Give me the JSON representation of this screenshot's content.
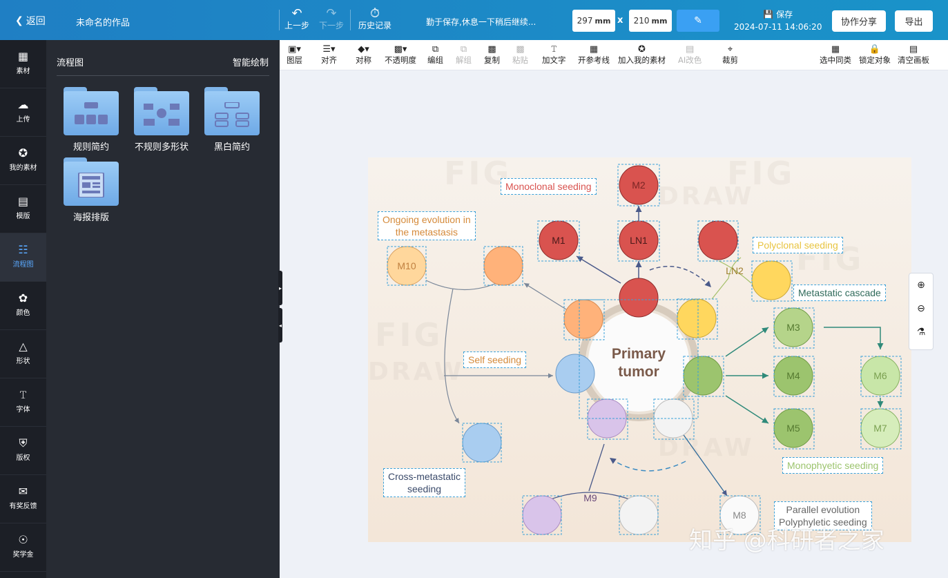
{
  "header": {
    "back_label": "返回",
    "doc_title": "未命名的作品",
    "undo_label": "上一步",
    "redo_label": "下一步",
    "history_label": "历史记录",
    "save_hint": "勤于保存,休息一下稍后继续...",
    "width_value": "297",
    "height_value": "210",
    "unit": "mm",
    "times": "x",
    "save_label": "保存",
    "save_time": "2024-07-11 14:06:20",
    "share_label": "协作分享",
    "export_label": "导出"
  },
  "leftnav": {
    "items": [
      {
        "label": "素材",
        "icon": "grid-icon"
      },
      {
        "label": "上传",
        "icon": "upload-icon"
      },
      {
        "label": "我的素材",
        "icon": "star-icon"
      },
      {
        "label": "模版",
        "icon": "template-icon"
      },
      {
        "label": "流程图",
        "icon": "flowchart-icon"
      },
      {
        "label": "颜色",
        "icon": "palette-icon"
      },
      {
        "label": "形状",
        "icon": "shapes-icon"
      },
      {
        "label": "字体",
        "icon": "text-icon"
      },
      {
        "label": "版权",
        "icon": "copyright-icon"
      },
      {
        "label": "有奖反馈",
        "icon": "feedback-icon"
      },
      {
        "label": "奖学金",
        "icon": "medal-icon"
      }
    ]
  },
  "panel": {
    "title": "流程图",
    "smart_label": "智能绘制",
    "folders": [
      {
        "label": "规则简约"
      },
      {
        "label": "不规则多形状"
      },
      {
        "label": "黑白简约"
      },
      {
        "label": "海报排版"
      }
    ]
  },
  "toolbar": {
    "tools": [
      {
        "label": "图层",
        "icon": "layer-icon"
      },
      {
        "label": "对齐",
        "icon": "align-icon"
      },
      {
        "label": "对称",
        "icon": "symmetry-icon"
      },
      {
        "label": "不透明度",
        "icon": "opacity-icon"
      },
      {
        "label": "编组",
        "icon": "group-icon"
      },
      {
        "label": "解组",
        "icon": "ungroup-icon"
      },
      {
        "label": "复制",
        "icon": "copy-icon"
      },
      {
        "label": "粘贴",
        "icon": "paste-icon"
      },
      {
        "label": "加文字",
        "icon": "add-text-icon"
      },
      {
        "label": "开参考线",
        "icon": "guide-icon"
      },
      {
        "label": "加入我的素材",
        "icon": "add-material-icon"
      },
      {
        "label": "AI改色",
        "icon": "ai-color-icon"
      },
      {
        "label": "裁剪",
        "icon": "crop-icon"
      },
      {
        "label": "选中同类",
        "icon": "select-similar-icon"
      },
      {
        "label": "锁定对象",
        "icon": "lock-icon"
      },
      {
        "label": "清空画板",
        "icon": "clear-icon"
      }
    ]
  },
  "diagram": {
    "center_line1": "Primary",
    "center_line2": "tumor",
    "nodes": {
      "M1": "M1",
      "M2": "M2",
      "LN1": "LN1",
      "LN2": "LN2",
      "M3": "M3",
      "M4": "M4",
      "M5": "M5",
      "M6": "M6",
      "M7": "M7",
      "M8": "M8",
      "M9": "M9",
      "M10": "M10"
    },
    "annotations": {
      "monoclonal": "Monoclonal seeding",
      "ongoing1": "Ongoing evolution in",
      "ongoing2": "the metastasis",
      "polyclonal": "Polyclonal seeding",
      "cascade": "Metastatic cascade",
      "self": "Self seeding",
      "cross1": "Cross-metastatic",
      "cross2": "seeding",
      "monophyletic": "Monophyetic seeding",
      "parallel1": "Parallel evolution",
      "parallel2": "Polyphyletic seeding"
    },
    "watermark_fig": "FIG",
    "watermark_draw": "DRAW",
    "colors": {
      "red": "#d9534f",
      "orange": "#ffb27a",
      "yellow": "#ffd75e",
      "green": "#9cc46e",
      "lightgreen": "#c8e6a8",
      "blue": "#a9cdf0",
      "purple": "#d9c4ea",
      "white": "#f3f3f3"
    }
  },
  "watermark_text": "知乎 @科研者之家",
  "zoom": {
    "zoom_in_icon": "zoom-in-icon",
    "zoom_out_icon": "zoom-out-icon",
    "fill_icon": "paint-bucket-icon"
  }
}
